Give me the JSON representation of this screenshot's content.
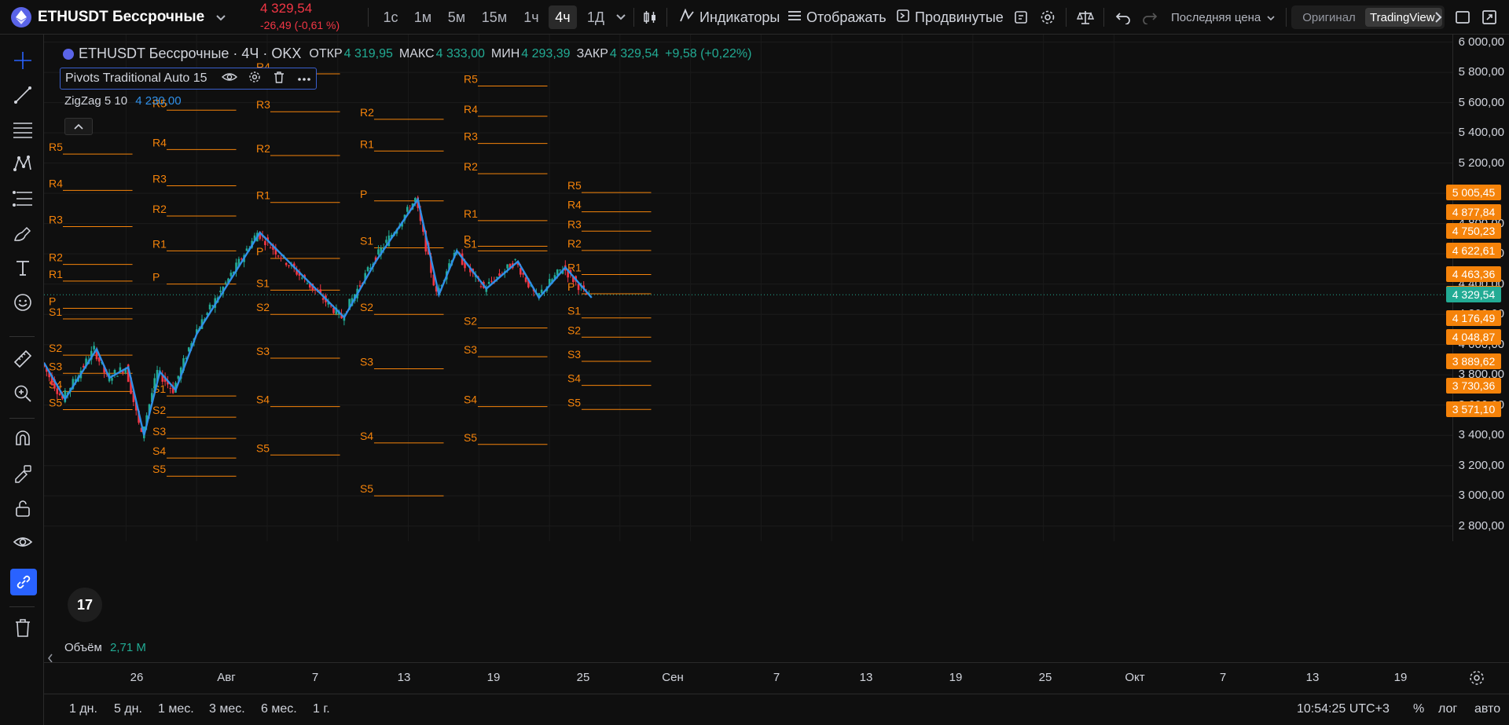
{
  "colors": {
    "background": "#0f0f0f",
    "pivot_line": "#f5830a",
    "pivot_label": "#f5830a",
    "zigzag": "#2f8fe8",
    "candle_up": "#22ab94",
    "candle_down": "#f23645",
    "accent": "#2962ff",
    "last_price_badge": "#22ab94",
    "price_down": "#f23645"
  },
  "header": {
    "symbol": "ETHUSDT Бессрочные",
    "last_price": "4 329,54",
    "change": "-26,49 (-0,61 %)",
    "timeframes": [
      "1с",
      "1м",
      "5м",
      "15м",
      "1ч",
      "4ч",
      "1Д"
    ],
    "active_timeframe": "4ч",
    "indicators_label": "Индикаторы",
    "display_label": "Отображать",
    "advanced_label": "Продвинутые",
    "price_source_label": "Последняя цена",
    "original_label": "Оригинал",
    "tradingview_label": "TradingView"
  },
  "legend": {
    "title": "ETHUSDT Бессрочные · 4Ч · OKX",
    "open_label": "ОТКР",
    "open_value": "4 319,95",
    "high_label": "МАКС",
    "high_value": "4 333,00",
    "low_label": "МИН",
    "low_value": "4 293,39",
    "close_label": "ЗАКР",
    "close_value": "4 329,54",
    "change_value": "+9,58 (+0,22%)"
  },
  "indicators": {
    "pivots": "Pivots Traditional Auto 15",
    "zigzag_name": "ZigZag 5 10",
    "zigzag_value": "4 230,00",
    "volume_name": "Объём",
    "volume_value": "2,71 M"
  },
  "price_axis": {
    "labels": [
      "6 000,00",
      "5 800,00",
      "5 600,00",
      "5 400,00",
      "5 200,00",
      "4 800,00",
      "4 600,00",
      "4 400,00",
      "4 200,00",
      "4 000,00",
      "3 800,00",
      "3 600,00",
      "3 400,00",
      "3 200,00",
      "3 000,00",
      "2 800,00"
    ],
    "badges": [
      {
        "name": "R5",
        "value": "5 005,45"
      },
      {
        "name": "R4",
        "value": "4 877,84"
      },
      {
        "name": "R3",
        "value": "4 750,23"
      },
      {
        "name": "R2",
        "value": "4 622,61"
      },
      {
        "name": "R1",
        "value": "4 463,36"
      },
      {
        "name": "P",
        "value": "4 335,74"
      },
      {
        "name": "S1",
        "value": "4 176,49"
      },
      {
        "name": "S2",
        "value": "4 048,87"
      },
      {
        "name": "S3",
        "value": "3 889,62"
      },
      {
        "name": "S4",
        "value": "3 730,36"
      },
      {
        "name": "S5",
        "value": "3 571,10"
      }
    ],
    "last": "4 329,54"
  },
  "time_axis": {
    "labels": [
      "26",
      "Авг",
      "7",
      "13",
      "19",
      "25",
      "Сен",
      "7",
      "13",
      "19",
      "25",
      "Окт",
      "7",
      "13",
      "19"
    ]
  },
  "bottom_bar": {
    "ranges": [
      "1 дн.",
      "5 дн.",
      "1 мес.",
      "3 мес.",
      "6 мес.",
      "1 г."
    ],
    "clock": "10:54:25 UTC+3",
    "percent": "%",
    "log": "лог",
    "auto": "авто"
  },
  "chart_data": {
    "type": "candlestick",
    "ylim": [
      2700,
      6050
    ],
    "x_labels": [
      "26",
      "Авг",
      "7",
      "13",
      "19",
      "25",
      "Сен",
      "7",
      "13",
      "19",
      "25",
      "Окт",
      "7",
      "13",
      "19"
    ],
    "pivot_periods": [
      {
        "levels": {
          "R5": 5260,
          "R4": 5020,
          "R3": 4780,
          "R2": 4530,
          "R1": 4420,
          "P": 4240,
          "S1": 4170,
          "S2": 3930,
          "S3": 3810,
          "S4": 3690,
          "S5": 3570
        }
      },
      {
        "levels": {
          "R5": 5550,
          "R4": 5290,
          "R3": 5050,
          "R2": 4850,
          "R1": 4620,
          "P": 4400,
          "S1": 3660,
          "S2": 3520,
          "S3": 3380,
          "S4": 3250,
          "S5": 3130
        }
      },
      {
        "levels": {
          "R4": 5790,
          "R3": 5540,
          "R2": 5250,
          "R1": 4940,
          "P": 4570,
          "S1": 4360,
          "S2": 4200,
          "S3": 3910,
          "S4": 3590,
          "S5": 3270
        }
      },
      {
        "levels": {
          "R2": 5490,
          "R1": 5280,
          "P": 4950,
          "S1": 4640,
          "S2": 4200,
          "S3": 3840,
          "S4": 3350,
          "S5": 3000
        }
      },
      {
        "levels": {
          "R5": 5710,
          "R4": 5510,
          "R3": 5330,
          "R2": 5130,
          "R1": 4820,
          "P": 4650,
          "S1": 4620,
          "S2": 4110,
          "S3": 3920,
          "S4": 3590,
          "S5": 3340
        }
      },
      {
        "levels": {
          "R5": 5005.45,
          "R4": 4877.84,
          "R3": 4750.23,
          "R2": 4622.61,
          "R1": 4463.36,
          "P": 4335.74,
          "S1": 4176.49,
          "S2": 4048.87,
          "S3": 3889.62,
          "S4": 3730.36,
          "S5": 3571.1
        }
      }
    ],
    "zigzag": [
      [
        0,
        3880
      ],
      [
        0.2,
        3640
      ],
      [
        0.5,
        3970
      ],
      [
        0.62,
        3780
      ],
      [
        0.8,
        3850
      ],
      [
        0.95,
        3400
      ],
      [
        1.1,
        3820
      ],
      [
        1.25,
        3700
      ],
      [
        1.45,
        4070
      ],
      [
        2.05,
        4740
      ],
      [
        2.85,
        4180
      ],
      [
        3.15,
        4550
      ],
      [
        3.55,
        4960
      ],
      [
        3.75,
        4330
      ],
      [
        3.92,
        4620
      ],
      [
        4.2,
        4370
      ],
      [
        4.5,
        4550
      ],
      [
        4.7,
        4310
      ],
      [
        4.95,
        4510
      ],
      [
        5.2,
        4310
      ]
    ],
    "last": 4329.54
  }
}
